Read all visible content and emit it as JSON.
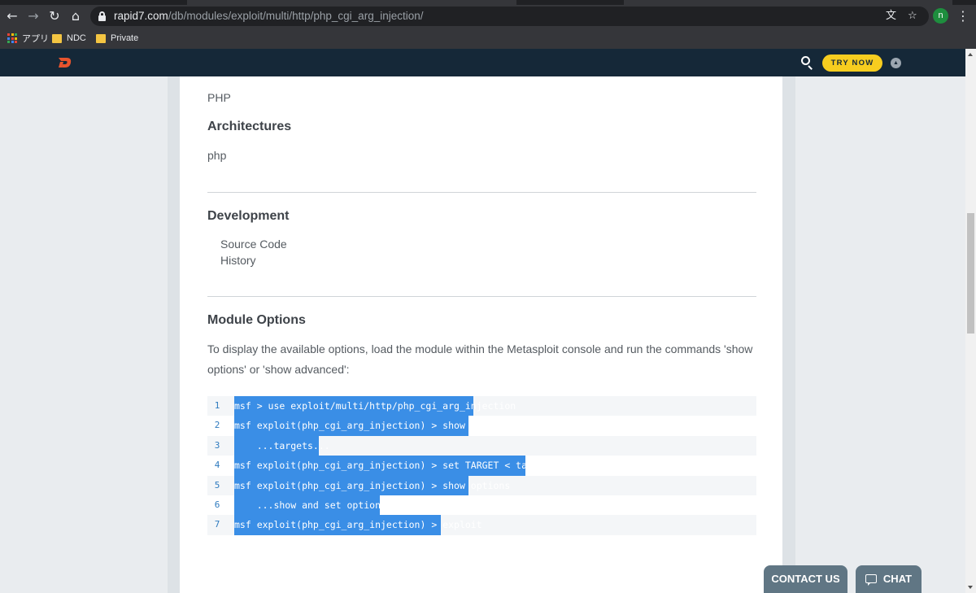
{
  "browser": {
    "url_host": "rapid7.com",
    "url_path": "/db/modules/exploit/multi/http/php_cgi_arg_injection/",
    "profile_initial": "n",
    "bookmarks": [
      {
        "label": "アプリ",
        "icon": "apps-grid-icon"
      },
      {
        "label": "NDC",
        "icon": "folder-icon"
      },
      {
        "label": "Private",
        "icon": "folder-icon"
      }
    ]
  },
  "header": {
    "try_now": "TRY NOW"
  },
  "content": {
    "platform_value": "PHP",
    "architectures_heading": "Architectures",
    "architectures_value": "php",
    "development_heading": "Development",
    "dev_links": [
      "Source Code",
      "History"
    ],
    "module_options_heading": "Module Options",
    "module_options_text": "To display the available options, load the module within the Metasploit console and run the commands 'show options' or 'show advanced':",
    "code_lines": [
      {
        "num": "1",
        "text": "msf > use exploit/multi/http/php_cgi_arg_injection"
      },
      {
        "num": "2",
        "text": "msf exploit(php_cgi_arg_injection) > show targets"
      },
      {
        "num": "3",
        "text": "    ...targets..."
      },
      {
        "num": "4",
        "text": "msf exploit(php_cgi_arg_injection) > set TARGET < target-id >"
      },
      {
        "num": "5",
        "text": "msf exploit(php_cgi_arg_injection) > show options"
      },
      {
        "num": "6",
        "text": "    ...show and set options..."
      },
      {
        "num": "7",
        "text": "msf exploit(php_cgi_arg_injection) > exploit"
      }
    ]
  },
  "footer_buttons": {
    "contact": "CONTACT US",
    "chat": "CHAT"
  },
  "colors": {
    "site_header": "#152838",
    "try_now_bg": "#f7cd1f",
    "selection": "#3a8ee6",
    "line_number": "#2f7bbf",
    "floating_button": "#607684"
  }
}
